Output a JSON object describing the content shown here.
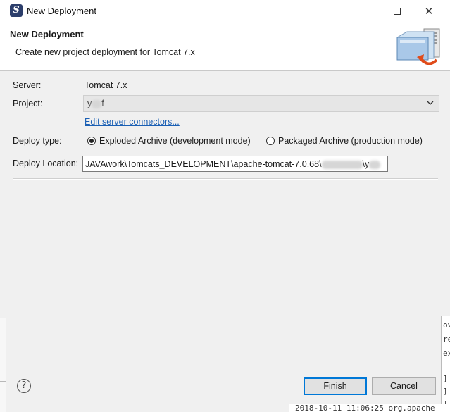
{
  "window": {
    "title": "New Deployment",
    "icon": "app-logo-icon"
  },
  "header": {
    "title": "New Deployment",
    "description": "Create new project deployment for Tomcat  7.x",
    "image": "deployment-wizard-icon"
  },
  "form": {
    "server_label": "Server:",
    "server_value": "Tomcat  7.x",
    "project_label": "Project:",
    "project_value": "y",
    "project_value_tail": "f",
    "edit_link": "Edit server connectors...",
    "deploy_type_label": "Deploy type:",
    "deploy_type_options": [
      {
        "label": "Exploded Archive (development mode)",
        "selected": true
      },
      {
        "label": "Packaged Archive (production mode)",
        "selected": false
      }
    ],
    "deploy_location_label": "Deploy Location:",
    "deploy_location_value": "JAVAwork\\Tomcats_DEVELOPMENT\\apache-tomcat-7.0.68\\",
    "deploy_location_tail": "\\y"
  },
  "footer": {
    "help_label": "?",
    "finish_label": "Finish",
    "cancel_label": "Cancel"
  },
  "background": {
    "log_line": "2018-10-11 11:06:25 org.apache",
    "right_fragments": [
      "ov",
      "re",
      "ex",
      "]",
      "]",
      "]"
    ]
  }
}
